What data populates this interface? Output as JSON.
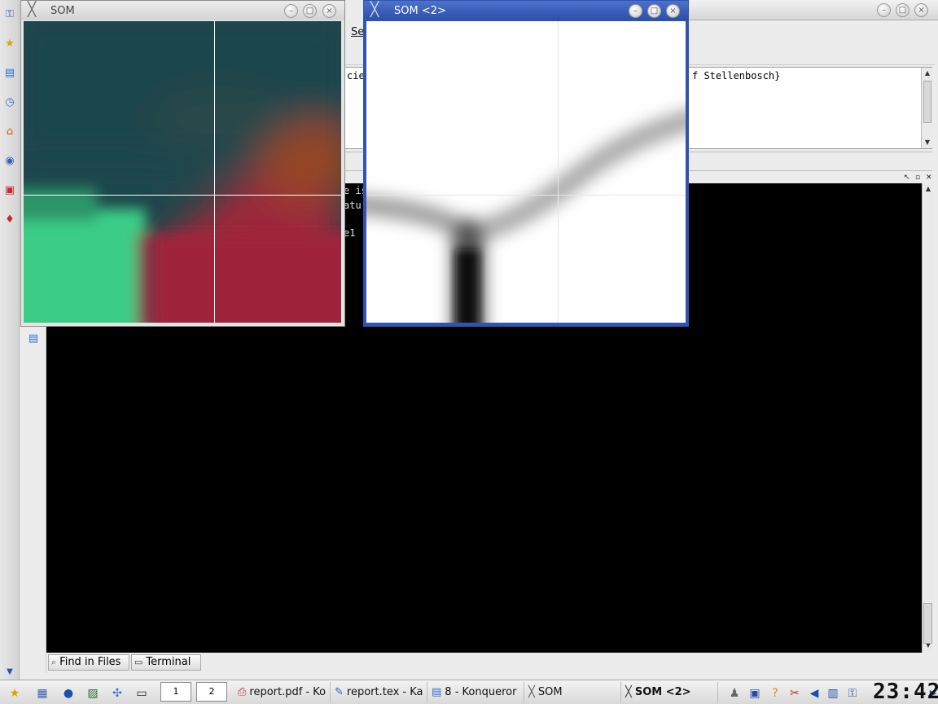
{
  "background_app": {
    "menu_fragment": "Se",
    "editor_line_left": "cie",
    "editor_line_right": "f Stellenbosch}",
    "term_fragment_1": "e is",
    "term_fragment_2": "atu",
    "term_fragment_3": "e1",
    "tool_tabs": [
      {
        "label": "Find in Files",
        "icon": "search-icon"
      },
      {
        "label": "Terminal",
        "icon": "terminal-icon"
      }
    ]
  },
  "som_window_1": {
    "title": "SOM",
    "colors": {
      "teal": "#1f4a4f",
      "green": "#44e08a",
      "red": "#b0263c",
      "orange": "#a0482a"
    }
  },
  "som_window_2": {
    "title": "SOM <2>",
    "title_bar_color": "#2f53b2"
  },
  "taskbar": {
    "desktops": [
      "1",
      "2"
    ],
    "tasks": [
      {
        "label": "report.pdf - Ko",
        "icon": "pdf-icon"
      },
      {
        "label": "report.tex - Ka",
        "icon": "editor-icon"
      },
      {
        "label": "8 - Konqueror",
        "icon": "folder-icon"
      },
      {
        "label": "SOM",
        "icon": "x-icon"
      },
      {
        "label": "SOM <2>",
        "icon": "x-icon"
      }
    ],
    "clock": "23:42"
  }
}
